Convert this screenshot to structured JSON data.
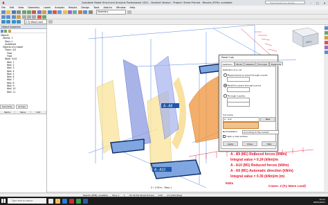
{
  "window": {
    "title": "Autodesk Robot Structural Analysis Professional 2021 - Student Version - Project: Sheet Primed - Results (FEM): available",
    "help_placeholder": "Type keyword or phrase"
  },
  "menu": [
    "File",
    "Edit",
    "View",
    "Geometry",
    "Loads",
    "Analysis",
    "Results",
    "Design",
    "Tools",
    "Add-Ins",
    "Window",
    "Help"
  ],
  "toolbar": {
    "view_select": "Geometry",
    "load_case": "2: Fy Wave Load"
  },
  "object_inspector": {
    "title": "Object Inspector",
    "tree": [
      {
        "label": "Objects",
        "count": "",
        "indent": 0
      },
      {
        "label": "Stories",
        "count": "1",
        "indent": 1
      },
      {
        "label": "Story 1",
        "count": "",
        "indent": 2
      },
      {
        "label": "Undefined",
        "count": "",
        "indent": 2
      },
      {
        "label": "Objects of a model",
        "count": "",
        "indent": 1
      },
      {
        "label": "Floors",
        "count": "0/2",
        "indent": 2
      },
      {
        "label": "Floor",
        "count": "",
        "indent": 3
      },
      {
        "label": "Floor",
        "count": "",
        "indent": 3
      },
      {
        "label": "Walls",
        "count": "0/14",
        "indent": 2
      },
      {
        "label": "Wall",
        "count": "1",
        "indent": 3
      },
      {
        "label": "Wall",
        "count": "2",
        "indent": 3
      },
      {
        "label": "Wall",
        "count": "3",
        "indent": 3
      },
      {
        "label": "Wall",
        "count": "4",
        "indent": 3
      },
      {
        "label": "Wall",
        "count": "5",
        "indent": 3
      },
      {
        "label": "Wall",
        "count": "6",
        "indent": 3
      },
      {
        "label": "Wall",
        "count": "7",
        "indent": 3
      },
      {
        "label": "Wall",
        "count": "8",
        "indent": 3
      },
      {
        "label": "Wall",
        "count": "9",
        "indent": 3
      },
      {
        "label": "Wall",
        "count": "10",
        "indent": 3
      },
      {
        "label": "Wall",
        "count": "11",
        "indent": 3
      }
    ],
    "tabs": [
      "Geometry",
      "Groups"
    ],
    "columns": [
      "Name",
      "Value",
      "Unit"
    ]
  },
  "viewport": {
    "section_labels": [
      "A - A9",
      "A - A10",
      "A - A10"
    ],
    "view_name": "Z = 0.00 m - Story 1",
    "cube_label": "LEFT",
    "legend_lines": [
      {
        "text": "A - A9 (M1) Reduced forces (kN/m)",
        "color": "#e8132d"
      },
      {
        "text": "Integral value = 0.24 (kNm)/m",
        "color": "#e8132d"
      },
      {
        "text": "A - A10 (M1) Reduced forces (kN/m)",
        "color": "#e8132d"
      },
      {
        "text": "A - A9 (M1) Automatic direction (kN/m)",
        "color": "#e8132d"
      },
      {
        "text": "Integral value = 0.30 (kNm)/m (m)",
        "color": "#e8132d"
      }
    ],
    "unit_label": "kN/m",
    "cases_label": "Cases: 2 (Fy Wave Load)",
    "accent_color": "#1e5aa8"
  },
  "dialog": {
    "title": "Panel Cuts",
    "tabs": [
      "Definition",
      "Mode",
      "Detailed",
      "Principal",
      "Diagrams"
    ],
    "definition_label": "Definition of a cut",
    "options": [
      {
        "label": "Perpendicular to plane through a point",
        "selected": false
      },
      {
        "label": "Parallel to plane through a point",
        "selected": true
      },
      {
        "label": "Through 2 points",
        "selected": false
      }
    ],
    "cut_name_label": "Cut name",
    "cut_name_value": "A - A11",
    "new_button": "New",
    "normalization_label": "Normalization",
    "normalization_value": "according to the current",
    "open_window_label": "Open a new window",
    "apply_button": "Apply",
    "close_button": "Close",
    "help_button": "Help"
  },
  "statusbar": {
    "items": [
      "Results (FEM): available",
      "Story 1",
      "1",
      "UC:30 Pvt Sheet Primed",
      "0.00",
      "(m) [kN] [Deg]"
    ]
  },
  "taskbar": {
    "search_placeholder": "Type here to search",
    "time": "15:51",
    "date": "28/05/2021"
  }
}
